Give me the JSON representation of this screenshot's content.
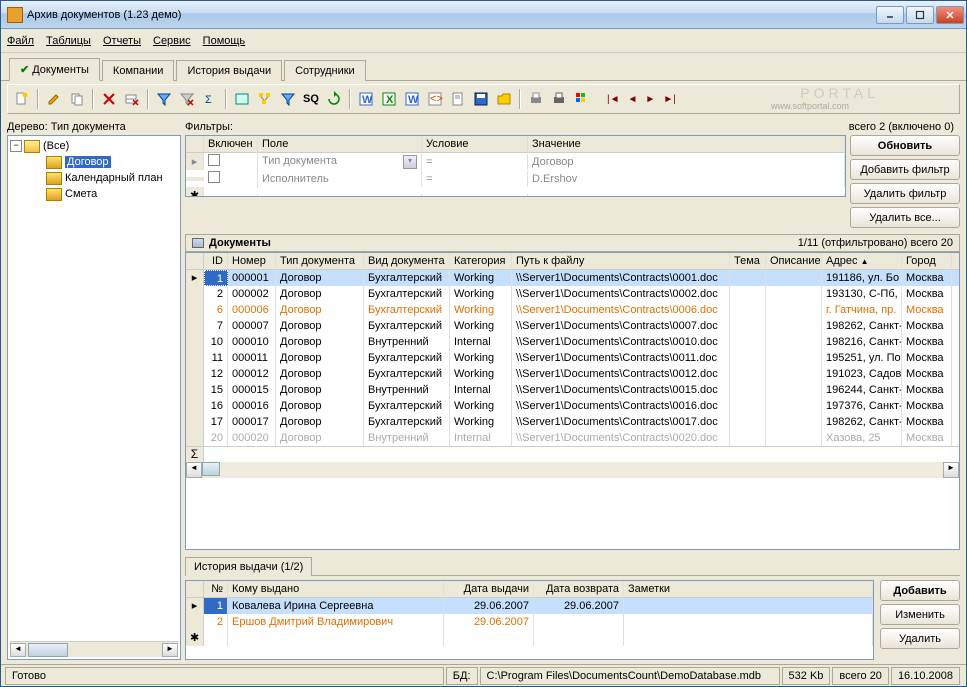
{
  "title": "Архив документов (1.23 демо)",
  "menu": [
    "Файл",
    "Таблицы",
    "Отчеты",
    "Сервис",
    "Помощь"
  ],
  "tabs": [
    "Документы",
    "Компании",
    "История выдачи",
    "Сотрудники"
  ],
  "tree_label": "Дерево: Тип документа",
  "tree": {
    "root": "(Все)",
    "items": [
      "Договор",
      "Календарный план",
      "Смета"
    ]
  },
  "filters_label": "Фильтры:",
  "count_label": "всего 2 (включено 0)",
  "filter_cols": {
    "on": "Включен",
    "field": "Поле",
    "cond": "Условие",
    "val": "Значение"
  },
  "filter_rows": [
    {
      "field": "Тип документа",
      "cond": "=",
      "val": "Договор"
    },
    {
      "field": "Исполнитель",
      "cond": "=",
      "val": "D.Ershov"
    }
  ],
  "btns": {
    "refresh": "Обновить",
    "addf": "Добавить фильтр",
    "delf": "Удалить фильтр",
    "delall": "Удалить все..."
  },
  "grid_title": "Документы",
  "grid_count": "1/11 (отфильтровано)  всего 20",
  "gcols": {
    "id": "ID",
    "num": "Номер",
    "type": "Тип документа",
    "kind": "Вид документа",
    "cat": "Категория",
    "path": "Путь к файлу",
    "tema": "Тема",
    "desc": "Описание",
    "addr": "Адрес",
    "city": "Город"
  },
  "rows": [
    {
      "id": "1",
      "num": "000001",
      "type": "Договор",
      "kind": "Бухгалтерский",
      "cat": "Working",
      "path": "\\\\Server1\\Documents\\Contracts\\0001.doc",
      "addr": "191186, ул. Бо",
      "city": "Москва",
      "sel": true
    },
    {
      "id": "2",
      "num": "000002",
      "type": "Договор",
      "kind": "Бухгалтерский",
      "cat": "Working",
      "path": "\\\\Server1\\Documents\\Contracts\\0002.doc",
      "addr": "193130, С-Пб,",
      "city": "Москва"
    },
    {
      "id": "6",
      "num": "000006",
      "type": "Договор",
      "kind": "Бухгалтерский",
      "cat": "Working",
      "path": "\\\\Server1\\Documents\\Contracts\\0006.doc",
      "addr": "г. Гатчина, пр.",
      "city": "Москва",
      "orange": true
    },
    {
      "id": "7",
      "num": "000007",
      "type": "Договор",
      "kind": "Бухгалтерский",
      "cat": "Working",
      "path": "\\\\Server1\\Documents\\Contracts\\0007.doc",
      "addr": "198262, Санкт-",
      "city": "Москва"
    },
    {
      "id": "10",
      "num": "000010",
      "type": "Договор",
      "kind": "Внутренний",
      "cat": "Internal",
      "path": "\\\\Server1\\Documents\\Contracts\\0010.doc",
      "addr": "198216, Санкт-",
      "city": "Москва"
    },
    {
      "id": "11",
      "num": "000011",
      "type": "Договор",
      "kind": "Бухгалтерский",
      "cat": "Working",
      "path": "\\\\Server1\\Documents\\Contracts\\0011.doc",
      "addr": "195251, ул. По",
      "city": "Москва"
    },
    {
      "id": "12",
      "num": "000012",
      "type": "Договор",
      "kind": "Бухгалтерский",
      "cat": "Working",
      "path": "\\\\Server1\\Documents\\Contracts\\0012.doc",
      "addr": "191023, Садов",
      "city": "Москва"
    },
    {
      "id": "15",
      "num": "000015",
      "type": "Договор",
      "kind": "Внутренний",
      "cat": "Internal",
      "path": "\\\\Server1\\Documents\\Contracts\\0015.doc",
      "addr": "196244, Санкт-",
      "city": "Москва"
    },
    {
      "id": "16",
      "num": "000016",
      "type": "Договор",
      "kind": "Бухгалтерский",
      "cat": "Working",
      "path": "\\\\Server1\\Documents\\Contracts\\0016.doc",
      "addr": "197376, Санкт-",
      "city": "Москва"
    },
    {
      "id": "17",
      "num": "000017",
      "type": "Договор",
      "kind": "Бухгалтерский",
      "cat": "Working",
      "path": "\\\\Server1\\Documents\\Contracts\\0017.doc",
      "addr": "198262, Санкт-",
      "city": "Москва"
    },
    {
      "id": "20",
      "num": "000020",
      "type": "Договор",
      "kind": "Внутренний",
      "cat": "Internal",
      "path": "\\\\Server1\\Documents\\Contracts\\0020.doc",
      "addr": "Хазова, 25",
      "city": "Москва",
      "gray": true
    }
  ],
  "subtab": "История выдачи (1/2)",
  "hcols": {
    "n": "№",
    "who": "Кому выдано",
    "d1": "Дата выдачи",
    "d2": "Дата возврата",
    "note": "Заметки"
  },
  "hrows": [
    {
      "n": "1",
      "who": "Ковалева Ирина Сергеевна",
      "d1": "29.06.2007",
      "d2": "29.06.2007",
      "sel": true
    },
    {
      "n": "2",
      "who": "Ершов Дмитрий Владимирович",
      "d1": "29.06.2007",
      "d2": "",
      "orange": true
    }
  ],
  "hbtns": {
    "add": "Добавить",
    "edit": "Изменить",
    "del": "Удалить"
  },
  "status": {
    "ready": "Готово",
    "db_label": "БД:",
    "db": "C:\\Program Files\\DocumentsCount\\DemoDatabase.mdb",
    "size": "532 Kb",
    "total": "всего 20",
    "date": "16.10.2008"
  },
  "watermark": "PORTAL",
  "watermark_sub": "www.softportal.com"
}
